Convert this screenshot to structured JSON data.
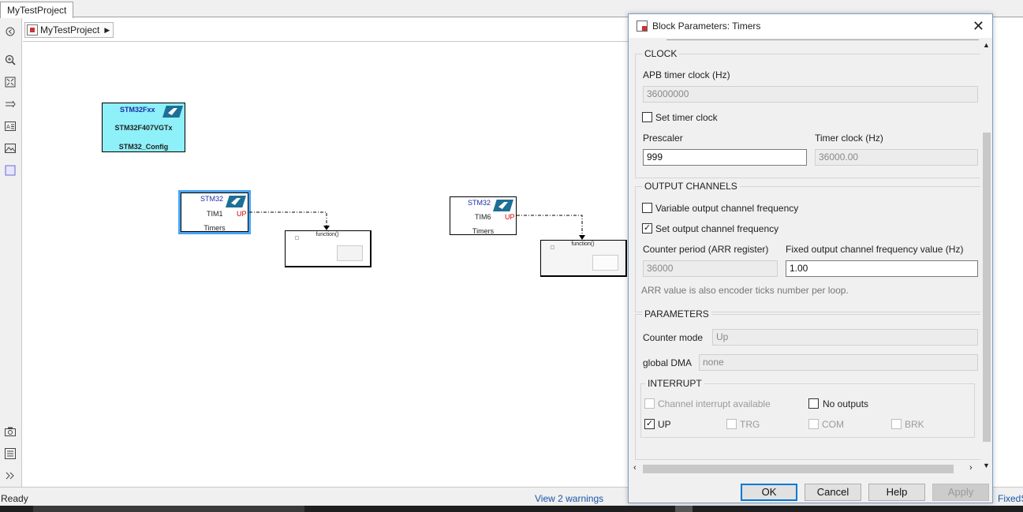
{
  "app": {
    "tab_label": "MyTestProject",
    "breadcrumb": "MyTestProject"
  },
  "canvas": {
    "config_block": {
      "family": "STM32Fxx",
      "device": "STM32F407VGTx",
      "name": "STM32_Config"
    },
    "tim1_block": {
      "header": "STM32",
      "timer": "TIM1",
      "port": "UP",
      "name": "Timers"
    },
    "tim6_block": {
      "header": "STM32",
      "timer": "TIM6",
      "port": "UP",
      "name": "Timers"
    },
    "func1_label": "function()",
    "func2_label": "function()"
  },
  "status": {
    "left": "Ready",
    "warnings": "View 2 warnings",
    "right": "FixedS"
  },
  "dialog": {
    "title": "Block Parameters: Timers",
    "clock": {
      "group_label": "CLOCK",
      "apb_label": "APB timer clock (Hz)",
      "apb_value": "36000000",
      "set_timer_clock_label": "Set timer clock",
      "set_timer_clock_checked": false,
      "prescaler_label": "Prescaler",
      "prescaler_value": "999",
      "timer_clock_label": "Timer clock (Hz)",
      "timer_clock_value": "36000.00"
    },
    "output": {
      "group_label": "OUTPUT CHANNELS",
      "variable_freq_label": "Variable output channel frequency",
      "variable_freq_checked": false,
      "set_freq_label": "Set output channel frequency",
      "set_freq_checked": true,
      "counter_period_label": "Counter period (ARR register)",
      "counter_period_value": "36000",
      "fixed_freq_label": "Fixed output channel frequency value (Hz)",
      "fixed_freq_value": "1.00",
      "note": "ARR value is also encoder ticks number per loop."
    },
    "parameters": {
      "group_label": "PARAMETERS",
      "counter_mode_label": "Counter mode",
      "counter_mode_value": "Up",
      "dma_label": "global DMA",
      "dma_value": "none"
    },
    "interrupt": {
      "group_label": "INTERRUPT",
      "channel_label": "Channel interrupt available",
      "no_outputs_label": "No outputs",
      "up_label": "UP",
      "trg_label": "TRG",
      "com_label": "COM",
      "brk_label": "BRK"
    },
    "buttons": {
      "ok": "OK",
      "cancel": "Cancel",
      "help": "Help",
      "apply": "Apply"
    }
  },
  "colors": {
    "config_block_fill": "#8ef0f8",
    "selection": "#4aa3f0",
    "port_red": "#d00000"
  }
}
